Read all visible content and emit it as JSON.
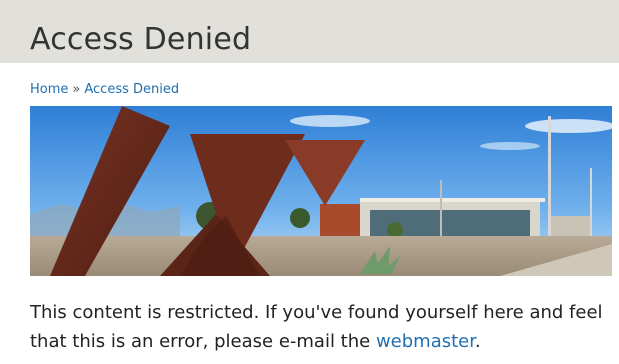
{
  "header": {
    "title": "Access Denied"
  },
  "breadcrumb": {
    "home": "Home",
    "separator": "»",
    "current": "Access Denied"
  },
  "banner": {
    "icon": "campus-sculpture-photo"
  },
  "message": {
    "text": "This content is restricted. If you've found yourself here and feel that this is an error, please e-mail the ",
    "link": "webmaster",
    "end": "."
  },
  "colors": {
    "header_bg": "#e2e0da",
    "link": "#1f6fb0",
    "sculpture": "#6b2a1c"
  }
}
